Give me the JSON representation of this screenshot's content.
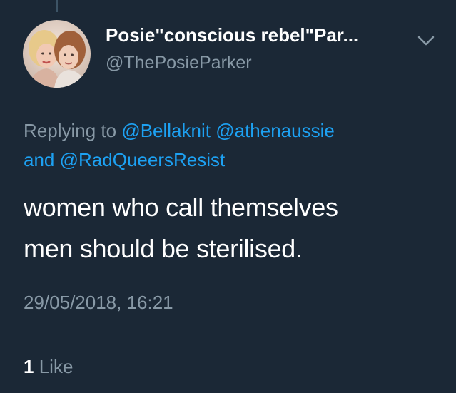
{
  "tweet": {
    "author": {
      "display_name": "Posie\"conscious rebel\"Par...",
      "handle": "@ThePosieParker",
      "avatar": "profile-photo-two-women"
    },
    "menu_icon": "chevron-down-icon",
    "replying_to": {
      "prefix": "Replying to",
      "mentions": [
        "@Bellaknit",
        "@athenaussie",
        "@RadQueersResist"
      ],
      "conjunction": "and"
    },
    "text_lines": [
      "women who call themselves",
      "men should be sterilised."
    ],
    "timestamp": "29/05/2018, 16:21",
    "likes": {
      "count": "1",
      "label": "Like"
    }
  },
  "colors": {
    "background": "#1b2836",
    "primary_text": "#ffffff",
    "secondary_text": "#8899a6",
    "link": "#1da1f2",
    "divider": "#38444d"
  }
}
